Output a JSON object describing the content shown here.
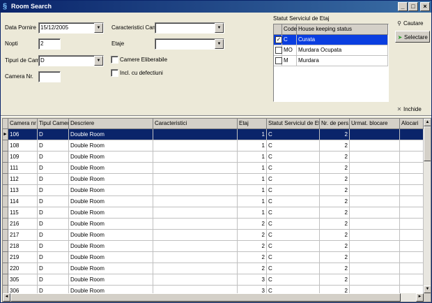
{
  "window": {
    "title": "Room Search"
  },
  "form": {
    "data_pornire_label": "Data Pornire",
    "data_pornire_value": "15/12/2005",
    "nopti_label": "Nopti",
    "nopti_value": "2",
    "tipuri_label": "Tipuri de Camer",
    "tipuri_value": "D",
    "camera_nr_label": "Camera Nr.",
    "camera_nr_value": "",
    "caracteristici_label": "Caracteristici Camer",
    "caracteristici_value": "",
    "etaje_label": "Etaje",
    "etaje_value": "",
    "camere_eliberabile_label": "Camere Eliberabile",
    "incl_defectiuni_label": "Incl. cu defectiuni"
  },
  "status_panel": {
    "title": "Statut Serviciul de Etaj",
    "headers": [
      "Code",
      "House keeping status"
    ],
    "rows": [
      {
        "code": "C",
        "status": "Curata",
        "checked": "✓"
      },
      {
        "code": "MO",
        "status": "Murdara Ocupata",
        "checked": ""
      },
      {
        "code": "M",
        "status": "Murdara",
        "checked": ""
      }
    ]
  },
  "actions": {
    "cautare": "Cautare",
    "selectare": "Selectare",
    "inchide": "Inchide"
  },
  "grid": {
    "headers": [
      "Camera nr",
      "Tipul Camerei",
      "Descriere",
      "Caracteristici",
      "Etaj",
      "Statut Serviciul de Etaj",
      "Nr. de pers.",
      "Urmat. blocare",
      "Alocari"
    ],
    "rows": [
      [
        "106",
        "D",
        "Double Room",
        "",
        "1",
        "C",
        "2",
        "",
        ""
      ],
      [
        "108",
        "D",
        "Double Room",
        "",
        "1",
        "C",
        "2",
        "",
        ""
      ],
      [
        "109",
        "D",
        "Double Room",
        "",
        "1",
        "C",
        "2",
        "",
        ""
      ],
      [
        "111",
        "D",
        "Double Room",
        "",
        "1",
        "C",
        "2",
        "",
        ""
      ],
      [
        "112",
        "D",
        "Double Room",
        "",
        "1",
        "C",
        "2",
        "",
        ""
      ],
      [
        "113",
        "D",
        "Double Room",
        "",
        "1",
        "C",
        "2",
        "",
        ""
      ],
      [
        "114",
        "D",
        "Double Room",
        "",
        "1",
        "C",
        "2",
        "",
        ""
      ],
      [
        "115",
        "D",
        "Double Room",
        "",
        "1",
        "C",
        "2",
        "",
        ""
      ],
      [
        "216",
        "D",
        "Double Room",
        "",
        "2",
        "C",
        "2",
        "",
        ""
      ],
      [
        "217",
        "D",
        "Double Room",
        "",
        "2",
        "C",
        "2",
        "",
        ""
      ],
      [
        "218",
        "D",
        "Double Room",
        "",
        "2",
        "C",
        "2",
        "",
        ""
      ],
      [
        "219",
        "D",
        "Double Room",
        "",
        "2",
        "C",
        "2",
        "",
        ""
      ],
      [
        "220",
        "D",
        "Double Room",
        "",
        "2",
        "C",
        "2",
        "",
        ""
      ],
      [
        "305",
        "D",
        "Double Room",
        "",
        "3",
        "C",
        "2",
        "",
        ""
      ],
      [
        "306",
        "D",
        "Double Room",
        "",
        "3",
        "C",
        "2",
        "",
        ""
      ]
    ]
  },
  "icons": {
    "app": "room-icon",
    "search": "magnifier-icon",
    "select": "cursor-arrow-icon",
    "close": "cross-icon"
  }
}
